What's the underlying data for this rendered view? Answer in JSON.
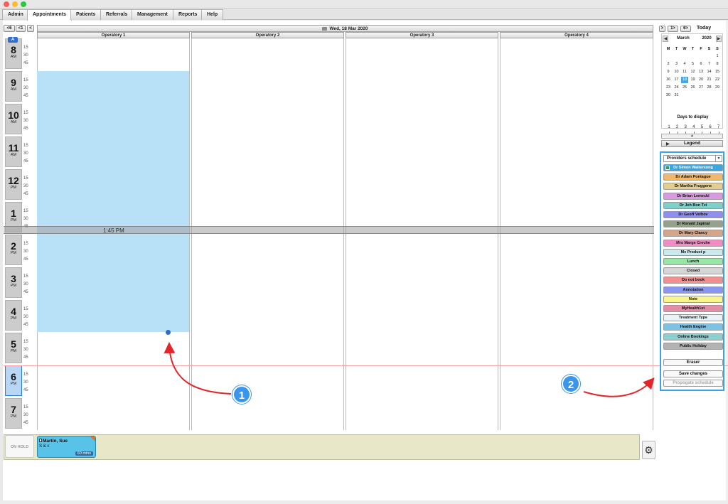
{
  "menu": {
    "tabs": [
      {
        "label": "Admin"
      },
      {
        "label": "Appointments"
      },
      {
        "label": "Patients"
      },
      {
        "label": "Referrals"
      },
      {
        "label": "Management"
      },
      {
        "label": "Reports"
      },
      {
        "label": "Help"
      }
    ],
    "active_tab": "Appointments"
  },
  "nav": {
    "back_week": "<6",
    "back_day": "<1",
    "back": "<",
    "forward": ">",
    "forward_day": "1>",
    "forward_week": "6>",
    "today": "Today"
  },
  "schedule": {
    "date_label": "Wed, 18 Mar 2020",
    "operatories": [
      {
        "label": "Operatory 1"
      },
      {
        "label": "Operatory 2"
      },
      {
        "label": "Operatory 3"
      },
      {
        "label": "Operatory 4"
      }
    ],
    "badge": "A",
    "hours": [
      {
        "num": "8",
        "ampm": "AM"
      },
      {
        "num": "9",
        "ampm": "AM"
      },
      {
        "num": "10",
        "ampm": "AM"
      },
      {
        "num": "11",
        "ampm": "AM"
      },
      {
        "num": "12",
        "ampm": "PM"
      },
      {
        "num": "1",
        "ampm": "PM"
      },
      {
        "num": "2",
        "ampm": "PM"
      },
      {
        "num": "3",
        "ampm": "PM"
      },
      {
        "num": "4",
        "ampm": "PM"
      },
      {
        "num": "5",
        "ampm": "PM"
      },
      {
        "num": "6",
        "ampm": "PM"
      },
      {
        "num": "7",
        "ampm": "PM"
      }
    ],
    "minute_labels": [
      "15",
      "30",
      "45"
    ],
    "current_hour": "6",
    "time_indicator": "1:45 PM"
  },
  "on_hold": {
    "button_label": "ON HOLD",
    "card": {
      "name": "Martin, Sue",
      "desc": "S & c",
      "duration": "60 mins"
    }
  },
  "calendar": {
    "month": "March",
    "year": "2020",
    "weekdays": [
      "M",
      "T",
      "W",
      "T",
      "F",
      "S",
      "S"
    ],
    "weeks": [
      [
        "",
        "",
        "",
        "",
        "",
        "",
        "1"
      ],
      [
        "2",
        "3",
        "4",
        "5",
        "6",
        "7",
        "8"
      ],
      [
        "9",
        "10",
        "11",
        "12",
        "13",
        "14",
        "15"
      ],
      [
        "16",
        "17",
        "18",
        "19",
        "20",
        "21",
        "22"
      ],
      [
        "23",
        "24",
        "25",
        "26",
        "27",
        "28",
        "29"
      ],
      [
        "30",
        "31",
        "",
        "",
        "",
        "",
        ""
      ]
    ],
    "selected_day": "18",
    "days_to_display_label": "Days to display",
    "days_options": [
      "1",
      "2",
      "3",
      "4",
      "5",
      "6",
      "7"
    ],
    "days_selected": 1
  },
  "legend": {
    "label": "Legend"
  },
  "providers": {
    "select_label": "Providers schedule",
    "items": [
      {
        "label": "Dr Simon Waltersong",
        "color": "#3aa6e6",
        "selected": true
      },
      {
        "label": "Dr Adam Pontague",
        "color": "#f2b768"
      },
      {
        "label": "Dr Martha Fruggens",
        "color": "#e3cd8f"
      },
      {
        "label": "Dr Brian Lemecki",
        "color": "#d79bde"
      },
      {
        "label": "Dr Jeh Bon Tzi",
        "color": "#7fd0c9"
      },
      {
        "label": "Dr Geoff Velhov",
        "color": "#8f8ff0"
      },
      {
        "label": "Dr Ronald Japinal",
        "color": "#95a28b"
      },
      {
        "label": "Dr Mary Clancy",
        "color": "#d4a58a"
      },
      {
        "label": "Mrs Marge Creche",
        "color": "#f38cc6"
      },
      {
        "label": "Mx Product p",
        "color": "#cbe8ec"
      },
      {
        "label": "Lunch",
        "color": "#98e6a6"
      },
      {
        "label": "Closed",
        "color": "#d5d5d5"
      },
      {
        "label": "Do not book",
        "color": "#f28f8f"
      },
      {
        "label": "Annotation",
        "color": "#8a97f2"
      },
      {
        "label": "Note",
        "color": "#f7f58c"
      },
      {
        "label": "MyHealth1st",
        "color": "#e38da7"
      },
      {
        "label": "Treatment Type",
        "color": "#eaf4f8"
      },
      {
        "label": "Health Engine",
        "color": "#7cc2e5"
      },
      {
        "label": "Online Bookings",
        "color": "#8fcfd1"
      },
      {
        "label": "Public Holiday",
        "color": "#b3b3b3"
      }
    ],
    "eraser": "Eraser",
    "save": "Save changes",
    "propagate": "Propogate schedule"
  },
  "callouts": {
    "one": "1",
    "two": "2"
  }
}
